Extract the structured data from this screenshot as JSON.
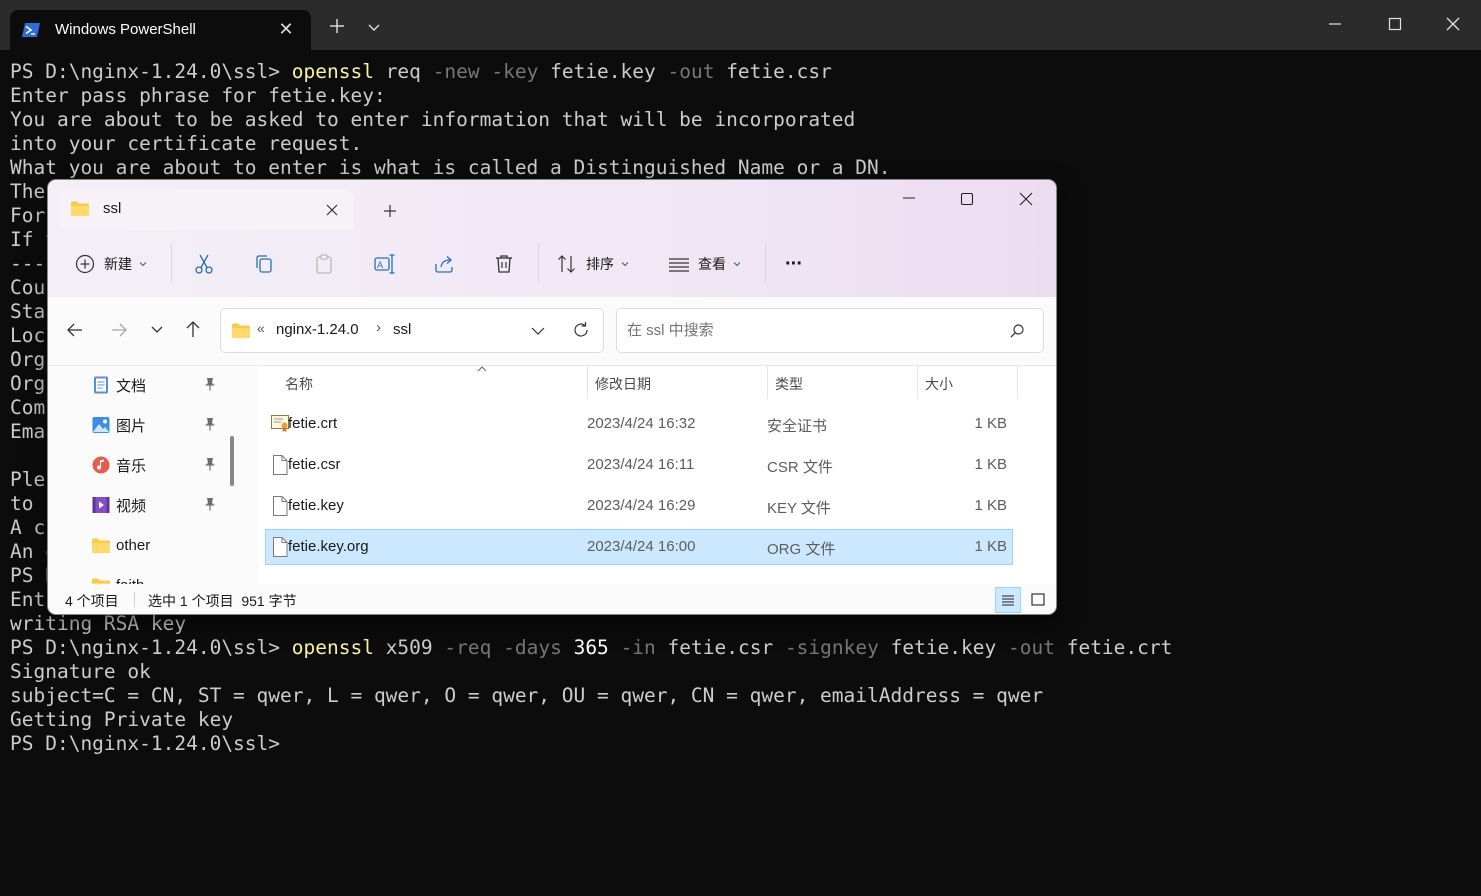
{
  "terminal": {
    "tab_title": "Windows PowerShell",
    "lines": [
      [
        [
          "PS D:\\nginx-1.24.0\\ssl> ",
          "plain"
        ],
        [
          "openssl",
          "cmd"
        ],
        [
          " req ",
          "plain"
        ],
        [
          "-new",
          "flag"
        ],
        [
          " ",
          "plain"
        ],
        [
          "-key",
          "flag"
        ],
        [
          " fetie.key ",
          "plain"
        ],
        [
          "-out",
          "flag"
        ],
        [
          " fetie.csr",
          "plain"
        ]
      ],
      [
        [
          "Enter pass phrase for fetie.key:",
          "plain"
        ]
      ],
      [
        [
          "You are about to be asked to enter information that will be incorporated",
          "plain"
        ]
      ],
      [
        [
          "into your certificate request.",
          "plain"
        ]
      ],
      [
        [
          "What you are about to enter is what is called a Distinguished Name or a DN.",
          "plain"
        ]
      ],
      [
        [
          "The",
          "plain"
        ]
      ],
      [
        [
          "For",
          "plain"
        ]
      ],
      [
        [
          "If y",
          "plain"
        ]
      ],
      [
        [
          "----",
          "plain"
        ]
      ],
      [
        [
          "Cou",
          "plain"
        ]
      ],
      [
        [
          "Sta",
          "plain"
        ]
      ],
      [
        [
          "Loc",
          "plain"
        ]
      ],
      [
        [
          "Org",
          "plain"
        ]
      ],
      [
        [
          "Org",
          "plain"
        ]
      ],
      [
        [
          "Com",
          "plain"
        ]
      ],
      [
        [
          "Ema",
          "plain"
        ]
      ],
      [
        [
          "",
          "plain"
        ]
      ],
      [
        [
          "Ple",
          "plain"
        ]
      ],
      [
        [
          "to b",
          "plain"
        ]
      ],
      [
        [
          "A c",
          "plain"
        ]
      ],
      [
        [
          "An o",
          "plain"
        ]
      ],
      [
        [
          "PS D",
          "plain"
        ]
      ],
      [
        [
          "Ent",
          "plain"
        ]
      ],
      [
        [
          "writing RSA key",
          "plain"
        ]
      ],
      [
        [
          "PS D:\\nginx-1.24.0\\ssl> ",
          "plain"
        ],
        [
          "openssl",
          "cmd"
        ],
        [
          " x509 ",
          "plain"
        ],
        [
          "-req",
          "flag"
        ],
        [
          " ",
          "plain"
        ],
        [
          "-days",
          "flag"
        ],
        [
          " ",
          "plain"
        ],
        [
          "365",
          "num"
        ],
        [
          " ",
          "plain"
        ],
        [
          "-in",
          "flag"
        ],
        [
          " fetie.csr ",
          "plain"
        ],
        [
          "-signkey",
          "flag"
        ],
        [
          " fetie.key ",
          "plain"
        ],
        [
          "-out",
          "flag"
        ],
        [
          " fetie.crt",
          "plain"
        ]
      ],
      [
        [
          "Signature ok",
          "plain"
        ]
      ],
      [
        [
          "subject=C = CN, ST = qwer, L = qwer, O = qwer, OU = qwer, CN = qwer, emailAddress = qwer",
          "plain"
        ]
      ],
      [
        [
          "Getting Private key",
          "plain"
        ]
      ],
      [
        [
          "PS D:\\nginx-1.24.0\\ssl>",
          "plain"
        ]
      ]
    ]
  },
  "explorer": {
    "tab_title": "ssl",
    "toolbar": {
      "new_label": "新建",
      "sort_label": "排序",
      "view_label": "查看",
      "more_label": "···"
    },
    "address": {
      "overflow": "«",
      "crumbs": [
        "nginx-1.24.0",
        "ssl"
      ],
      "separator": "›"
    },
    "search": {
      "placeholder": "在 ssl 中搜索"
    },
    "nav_items": [
      {
        "label": "文档",
        "icon": "documents-icon",
        "pinned": true
      },
      {
        "label": "图片",
        "icon": "pictures-icon",
        "pinned": true
      },
      {
        "label": "音乐",
        "icon": "music-icon",
        "pinned": true
      },
      {
        "label": "视频",
        "icon": "videos-icon",
        "pinned": true
      },
      {
        "label": "other",
        "icon": "folder-icon",
        "pinned": false
      },
      {
        "label": "faith",
        "icon": "folder-icon",
        "pinned": false
      }
    ],
    "columns": {
      "name": "名称",
      "modified": "修改日期",
      "type": "类型",
      "size": "大小"
    },
    "files": [
      {
        "name": "fetie.crt",
        "modified": "2023/4/24 16:32",
        "type": "安全证书",
        "size": "1 KB",
        "icon": "certificate-icon",
        "selected": false
      },
      {
        "name": "fetie.csr",
        "modified": "2023/4/24 16:11",
        "type": "CSR 文件",
        "size": "1 KB",
        "icon": "file-icon",
        "selected": false
      },
      {
        "name": "fetie.key",
        "modified": "2023/4/24 16:29",
        "type": "KEY 文件",
        "size": "1 KB",
        "icon": "file-icon",
        "selected": false
      },
      {
        "name": "fetie.key.org",
        "modified": "2023/4/24 16:00",
        "type": "ORG 文件",
        "size": "1 KB",
        "icon": "file-icon",
        "selected": true
      }
    ],
    "status": {
      "item_count": "4 个项目",
      "selection": "选中 1 个项目  951 字节"
    },
    "colors": {
      "selection_bg": "#cce8ff",
      "accent": "#0067c0",
      "folder": "#f8c94a"
    }
  }
}
